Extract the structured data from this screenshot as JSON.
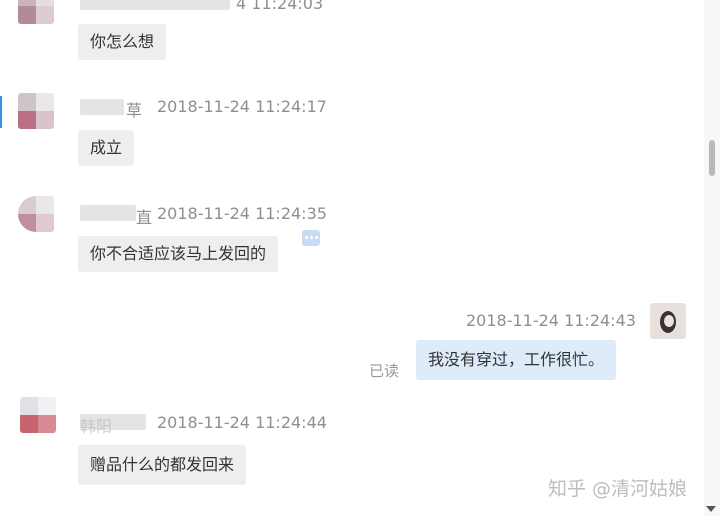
{
  "messages": [
    {
      "time": "4 11:24:03",
      "text": "你怎么想"
    },
    {
      "name_fragment": "草",
      "time": "2018-11-24 11:24:17",
      "text": "成立"
    },
    {
      "name_fragment": "直",
      "time": "2018-11-24 11:24:35",
      "text": "你不合适应该马上发回的"
    },
    {
      "time": "2018-11-24 11:24:43",
      "text": "我没有穿过，工作很忙。",
      "status": "已读"
    },
    {
      "name_fragment": "韩阳",
      "time": "2018-11-24 11:24:44",
      "text": "赠品什么的都发回来"
    }
  ],
  "watermark": "知乎 @清河姑娘",
  "icons": {
    "more": "more-dots-icon",
    "scroll_down": "scroll-down-arrow-icon"
  },
  "colors": {
    "incoming_bubble": "#eeeeee",
    "outgoing_bubble": "#ddebfa",
    "timestamp": "#8f8f8f"
  }
}
